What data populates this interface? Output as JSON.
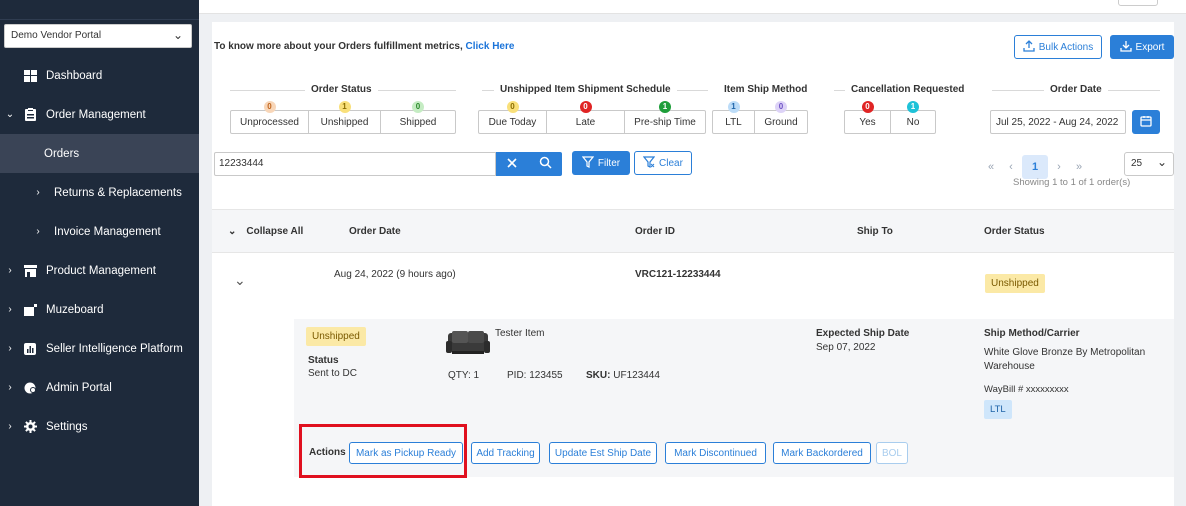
{
  "sidebar": {
    "portal_select": "Demo Vendor Portal",
    "items": [
      {
        "label": "Dashboard"
      },
      {
        "label": "Order Management"
      },
      {
        "label": "Orders"
      },
      {
        "label": "Returns & Replacements"
      },
      {
        "label": "Invoice Management"
      },
      {
        "label": "Product Management"
      },
      {
        "label": "Muzeboard"
      },
      {
        "label": "Seller Intelligence Platform"
      },
      {
        "label": "Admin Portal"
      },
      {
        "label": "Settings"
      }
    ]
  },
  "header": {
    "info_text": "To know more about your Orders fulfillment metrics,",
    "info_link": "Click Here",
    "bulk_actions": "Bulk Actions",
    "export": "Export"
  },
  "filters": {
    "order_status": {
      "title": "Order Status",
      "options": [
        {
          "label": "Unprocessed",
          "count": "0"
        },
        {
          "label": "Unshipped",
          "count": "1"
        },
        {
          "label": "Shipped",
          "count": "0"
        }
      ]
    },
    "schedule": {
      "title": "Unshipped Item Shipment Schedule",
      "options": [
        {
          "label": "Due Today",
          "count": "0"
        },
        {
          "label": "Late",
          "count": "0"
        },
        {
          "label": "Pre-ship Time",
          "count": "1"
        }
      ]
    },
    "ship_method": {
      "title": "Item Ship Method",
      "options": [
        {
          "label": "LTL",
          "count": "1"
        },
        {
          "label": "Ground",
          "count": "0"
        }
      ]
    },
    "cancellation": {
      "title": "Cancellation Requested",
      "options": [
        {
          "label": "Yes",
          "count": "0"
        },
        {
          "label": "No",
          "count": "1"
        }
      ]
    },
    "order_date": {
      "title": "Order Date",
      "value": "Jul 25, 2022 - Aug 24, 2022"
    }
  },
  "search": {
    "value": "12233444",
    "filter_label": "Filter",
    "clear_label": "Clear"
  },
  "pagination": {
    "current_page": "1",
    "per_page": "25",
    "showing": "Showing 1 to 1 of 1 order(s)"
  },
  "table": {
    "collapse_all": "Collapse All",
    "columns": [
      "Order Date",
      "Order ID",
      "Ship To",
      "Order Status"
    ]
  },
  "order": {
    "date": "Aug 24, 2022 (9 hours ago)",
    "id": "VRC121-12233444",
    "status": "Unshipped",
    "item": {
      "status_tag": "Unshipped",
      "status_label": "Status",
      "status_value": "Sent to DC",
      "name": "Tester Item",
      "qty": "QTY: 1",
      "pid": "PID: 123455",
      "sku_label": "SKU:",
      "sku_value": "UF123444",
      "expected_label": "Expected Ship Date",
      "expected_value": "Sep 07, 2022",
      "ship_method_label": "Ship Method/Carrier",
      "ship_method_value": "White Glove Bronze By Metropolitan Warehouse",
      "waybill": "WayBill # xxxxxxxxx",
      "method_tag": "LTL"
    },
    "actions_label": "Actions",
    "actions": [
      "Mark as Pickup Ready",
      "Add Tracking",
      "Update Est Ship Date",
      "Mark Discontinued",
      "Mark Backordered",
      "BOL"
    ]
  },
  "colors": {
    "sidebar_bg": "#1e2a3b",
    "accent": "#2b7fd8",
    "highlight_box": "#e0101f",
    "unshipped_tag": "#fbe9a6"
  }
}
